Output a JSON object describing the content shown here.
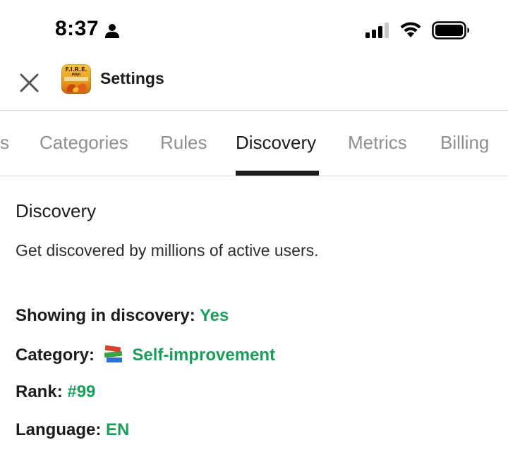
{
  "status_bar": {
    "time": "8:37"
  },
  "header": {
    "close_icon": "close-icon",
    "app_logo_text": "F.I.R.E.",
    "app_logo_sub": "MOJO",
    "title": "Settings"
  },
  "tabs": [
    {
      "label": "s",
      "active": false
    },
    {
      "label": "Categories",
      "active": false
    },
    {
      "label": "Rules",
      "active": false
    },
    {
      "label": "Discovery",
      "active": true
    },
    {
      "label": "Metrics",
      "active": false
    },
    {
      "label": "Billing",
      "active": false
    }
  ],
  "discovery": {
    "title": "Discovery",
    "description": "Get discovered by millions of active users.",
    "showing_label": "Showing in discovery:",
    "showing_value": "Yes",
    "category_label": "Category:",
    "category_icon": "books-icon",
    "category_value": "Self-improvement",
    "rank_label": "Rank:",
    "rank_value": "#99",
    "language_label": "Language:",
    "language_value": "EN"
  },
  "colors": {
    "accent_green": "#1a9e5a",
    "text_primary": "#1c1c1e",
    "text_inactive": "#8e8e93",
    "divider": "#dedede"
  }
}
